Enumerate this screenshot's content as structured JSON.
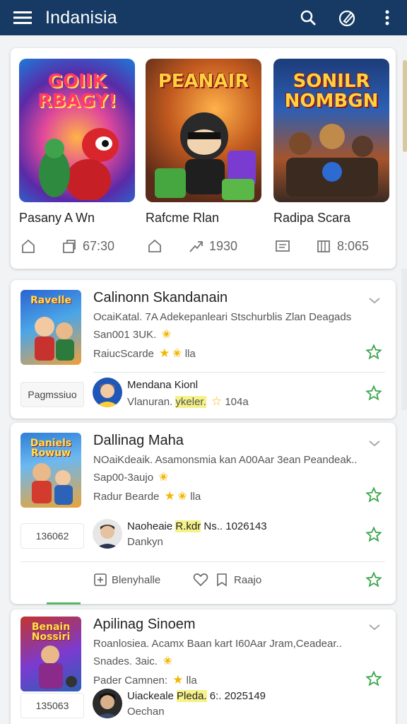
{
  "app": {
    "title": "Indanisia"
  },
  "carousel": [
    {
      "art_title": "GOIIK RBAGY!",
      "name": "Pasany A Wn",
      "stat1": "",
      "stat2": "67:30"
    },
    {
      "art_title": "PEANAIR",
      "name": "Rafcme Rlan",
      "stat1": "",
      "stat2": "1930"
    },
    {
      "art_title": "SONILR NOMBGN",
      "name": "Radipa Scara",
      "stat1": "",
      "stat2": "8:065"
    }
  ],
  "list": [
    {
      "title": "Calinonn Skandanain",
      "desc": "OcaiKatal. 7A Adekepanleari Stschurblis Zlan Deagads",
      "size": "San001 3UK.",
      "rate_label": "RaiucScarde",
      "rate_tail": "lla",
      "thumb_title": "Ravelle",
      "sub": {
        "tag": "Pagmssiuo",
        "line1": "Mendana Kionl",
        "line2_a": "Vlanuran.",
        "line2_b": "ykeler.",
        "line2_c": "104a"
      }
    },
    {
      "title": "Dallinag Maha",
      "desc": "NOaiKdeaik. Asamonsmia kan A00Aar 3ean Peandeak..",
      "size": "Sap00-3aujo",
      "rate_label": "Radur Bearde",
      "rate_tail": "lla",
      "thumb_title": "Daniels Rowuw",
      "sub": {
        "tag": "136062",
        "line1_a": "Naoheaie",
        "line1_b": "R.kdr",
        "line1_c": "Ns.. 1026143",
        "line2": "Dankyn"
      },
      "actions": {
        "a1": "Blenyhalle",
        "a3": "Raajo"
      }
    },
    {
      "title": "Apilinag Sinoem",
      "desc": "Roanlosiea. Acamx Baan kart I60Aar Jram,Ceadear..",
      "size": "Snades. 3aic.",
      "rate_label": "Pader Camnen:",
      "rate_tail": "lla",
      "thumb_title": "Benain Nossiri",
      "sub": {
        "tag": "135063",
        "line1_a": "Uiackeale",
        "line1_b": "Pleda.",
        "line1_c": "6:. 2025149",
        "line2": "Oechan"
      }
    }
  ],
  "colors": {
    "appbar": "#163a63",
    "star": "#f2b705",
    "fav": "#3aa54a"
  }
}
